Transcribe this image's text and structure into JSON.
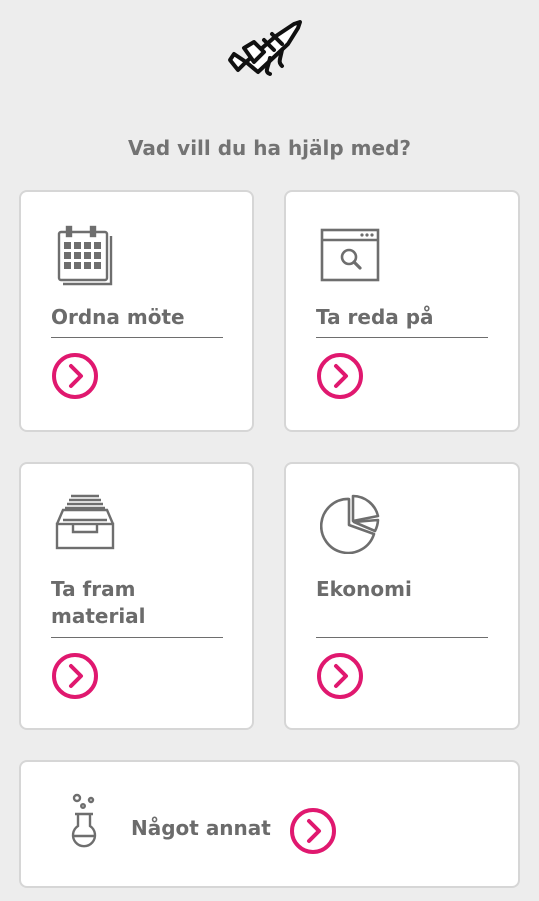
{
  "question": "Vad vill du ha hjälp med?",
  "accent_color": "#e0186f",
  "cards": [
    {
      "label": "Ordna möte",
      "icon": "calendar-icon"
    },
    {
      "label": "Ta reda på",
      "icon": "browser-search-icon"
    },
    {
      "label": "Ta fram material",
      "icon": "document-tray-icon"
    },
    {
      "label": "Ekonomi",
      "icon": "pie-chart-icon"
    }
  ],
  "other": {
    "label": "Något annat",
    "icon": "flask-icon"
  },
  "logo_icon": "rocket-icon",
  "arrow_icon": "chevron-right-circle-icon"
}
